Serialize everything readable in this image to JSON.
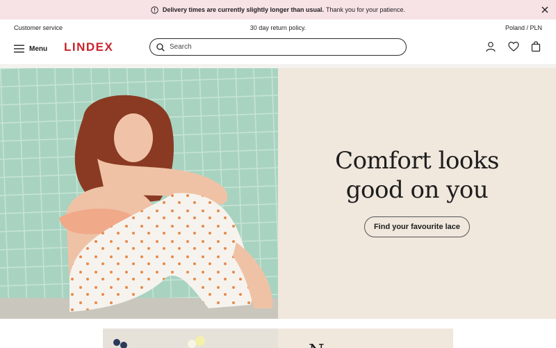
{
  "notice": {
    "bold_text": "Delivery times are currently slightly longer than usual.",
    "text": "Thank you for your patience."
  },
  "topbar": {
    "customer_service": "Customer service",
    "return_policy": "30 day return policy.",
    "region": "Poland / PLN"
  },
  "header": {
    "menu_label": "Menu",
    "logo": "LINDEX",
    "search_placeholder": "Search"
  },
  "hero": {
    "title_line1": "Comfort looks",
    "title_line2": "good on you",
    "button_label": "Find your favourite lace"
  },
  "next_section": {
    "title_partial": "N"
  },
  "colors": {
    "notice_bg": "#f7e2e6",
    "brand": "#c8232c",
    "hero_panel_bg": "#f0e7dd",
    "tile_green": "#a8d3c1"
  }
}
